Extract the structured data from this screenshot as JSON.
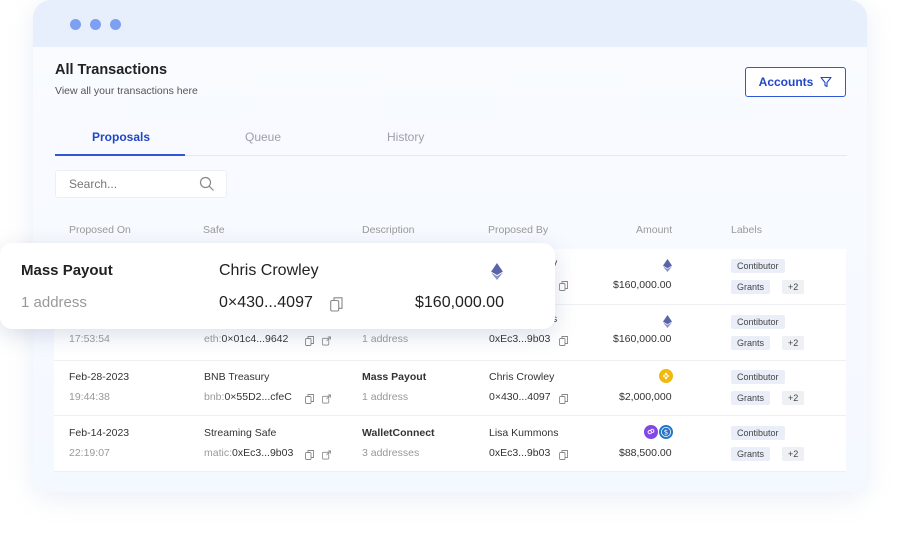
{
  "header": {
    "title": "All Transactions",
    "subtitle": "View all your transactions here",
    "accounts_button": "Accounts"
  },
  "tabs": [
    {
      "label": "Proposals",
      "active": true
    },
    {
      "label": "Queue",
      "active": false
    },
    {
      "label": "History",
      "active": false
    }
  ],
  "search": {
    "placeholder": "Search..."
  },
  "columns": [
    "Proposed On",
    "Safe",
    "Description",
    "Proposed By",
    "Amount",
    "Labels"
  ],
  "rows": [
    {
      "date": "",
      "time": "",
      "safe_name": "",
      "safe_prefix": "",
      "safe_address": "",
      "desc_title": "",
      "desc_sub": "",
      "proposer_name": "y",
      "proposer_address": "",
      "amount": "$160,000.00",
      "token": "eth-icon",
      "label1": "Contibutor",
      "label2": "Grants",
      "extra_labels": "+2"
    },
    {
      "date": "",
      "time": "17:53:54",
      "safe_name": "",
      "safe_prefix": "eth:",
      "safe_address": "0×01c4...9642",
      "desc_title": "",
      "desc_sub": "1 address",
      "proposer_name": "s",
      "proposer_address": "0xEc3...9b03",
      "amount": "$160,000.00",
      "token": "eth-icon",
      "label1": "Contibutor",
      "label2": "Grants",
      "extra_labels": "+2"
    },
    {
      "date": "Feb-28-2023",
      "time": "19:44:38",
      "safe_name": "BNB Treasury",
      "safe_prefix": "bnb:",
      "safe_address": "0×55D2...cfeC",
      "desc_title": "Mass Payout",
      "desc_sub": "1 address",
      "proposer_name": "Chris Crowley",
      "proposer_address": "0×430...4097",
      "amount": "$2,000,000",
      "token": "bnb-icon",
      "label1": "Contibutor",
      "label2": "Grants",
      "extra_labels": "+2"
    },
    {
      "date": "Feb-14-2023",
      "time": "22:19:07",
      "safe_name": "Streaming Safe",
      "safe_prefix": "matic:",
      "safe_address": "0xEc3...9b03",
      "desc_title": "WalletConnect",
      "desc_sub": "3 addresses",
      "proposer_name": "Lisa Kummons",
      "proposer_address": "0xEc3...9b03",
      "amount": "$88,500.00",
      "token": "matic-usdc-icons",
      "label1": "Contibutor",
      "label2": "Grants",
      "extra_labels": "+2"
    }
  ],
  "popup": {
    "title": "Mass Payout",
    "subtitle": "1 address",
    "proposer_name": "Chris Crowley",
    "proposer_address": "0×430...4097",
    "amount": "$160,000.00"
  },
  "colors": {
    "accent": "#2147c8",
    "window_dots": "#7f9ff0",
    "eth": "#5a64a8",
    "bnb": "#f0b90b",
    "matic": "#8247e5",
    "usdc": "#2775ca"
  }
}
